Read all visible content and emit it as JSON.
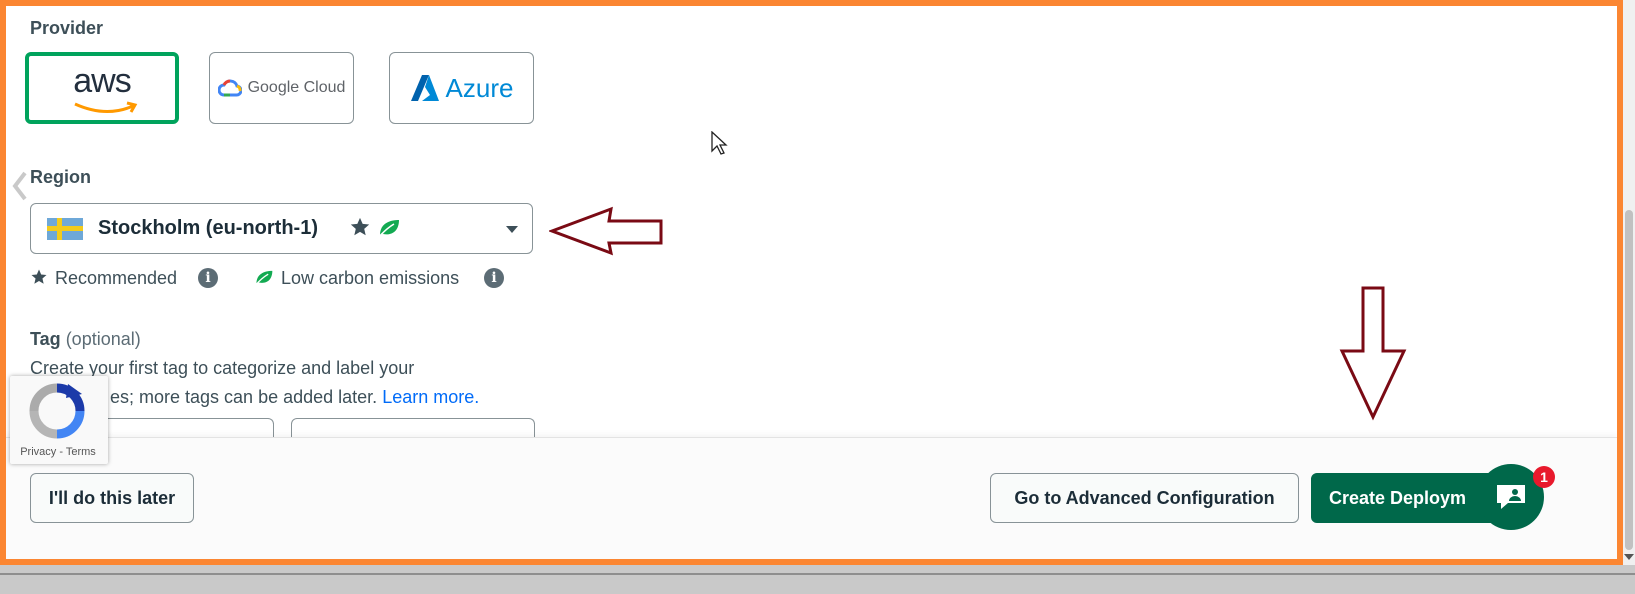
{
  "provider": {
    "label": "Provider",
    "options": [
      {
        "name": "aws",
        "logo_text": "aws",
        "selected": true
      },
      {
        "name": "google-cloud",
        "logo_text": "Google Cloud",
        "selected": false
      },
      {
        "name": "azure",
        "logo_text": "Azure",
        "selected": false
      }
    ]
  },
  "region": {
    "label": "Region",
    "value": "Stockholm (eu-north-1)",
    "flag": "sweden-flag",
    "legend": {
      "recommended": "Recommended",
      "low_carbon": "Low carbon emissions"
    }
  },
  "tag": {
    "title": "Tag",
    "optional": "(optional)",
    "desc_line1": "Create your first tag to categorize and label your",
    "desc_line2_prefix": "es; more tags can be added later.",
    "learn_more": "Learn more."
  },
  "captcha": {
    "text": "Privacy - Terms"
  },
  "footer": {
    "later_button": "I'll do this later",
    "advanced_button": "Go to Advanced Configuration",
    "create_button": "Create Deploym"
  },
  "chat": {
    "badge_count": "1"
  },
  "colors": {
    "frame": "#fb8632",
    "selected_border": "#00a35c",
    "primary": "#00684a",
    "annotation_arrow": "#7a0a14",
    "link": "#016bf8"
  }
}
